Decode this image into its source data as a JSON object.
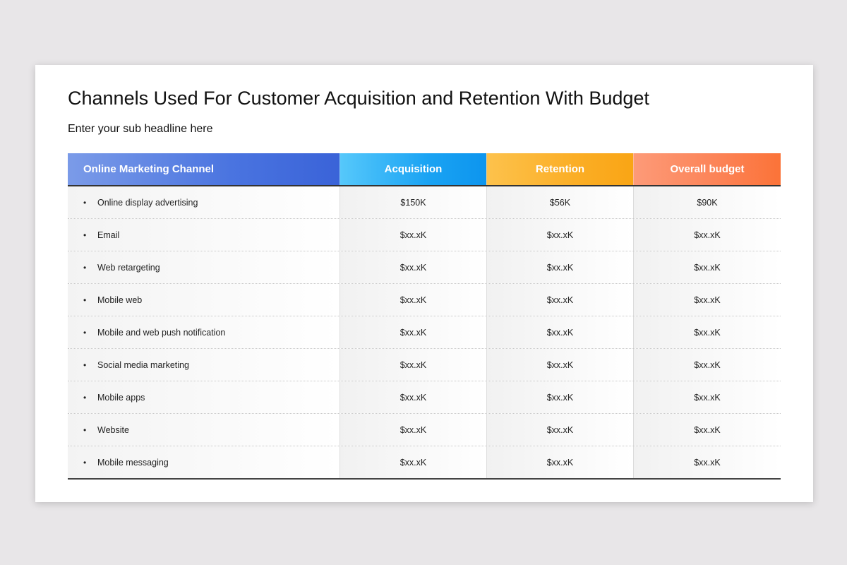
{
  "title": "Channels Used For Customer Acquisition and Retention With Budget",
  "subtitle": "Enter your sub headline here",
  "table": {
    "headers": [
      "Online Marketing Channel",
      "Acquisition",
      "Retention",
      "Overall budget"
    ],
    "rows": [
      {
        "channel": "Online display advertising",
        "acquisition": "$150K",
        "retention": "$56K",
        "budget": "$90K"
      },
      {
        "channel": "Email",
        "acquisition": "$xx.xK",
        "retention": "$xx.xK",
        "budget": "$xx.xK"
      },
      {
        "channel": "Web retargeting",
        "acquisition": "$xx.xK",
        "retention": "$xx.xK",
        "budget": "$xx.xK"
      },
      {
        "channel": "Mobile web",
        "acquisition": "$xx.xK",
        "retention": "$xx.xK",
        "budget": "$xx.xK"
      },
      {
        "channel": "Mobile and web push notification",
        "acquisition": "$xx.xK",
        "retention": "$xx.xK",
        "budget": "$xx.xK"
      },
      {
        "channel": "Social media marketing",
        "acquisition": "$xx.xK",
        "retention": "$xx.xK",
        "budget": "$xx.xK"
      },
      {
        "channel": "Mobile apps",
        "acquisition": "$xx.xK",
        "retention": "$xx.xK",
        "budget": "$xx.xK"
      },
      {
        "channel": "Website",
        "acquisition": "$xx.xK",
        "retention": "$xx.xK",
        "budget": "$xx.xK"
      },
      {
        "channel": "Mobile messaging",
        "acquisition": "$xx.xK",
        "retention": "$xx.xK",
        "budget": "$xx.xK"
      }
    ]
  },
  "colors": {
    "channel_header": "#4a74e0",
    "acquisition_header": "#1aa3f3",
    "retention_header": "#fbae26",
    "budget_header": "#fc8255"
  }
}
